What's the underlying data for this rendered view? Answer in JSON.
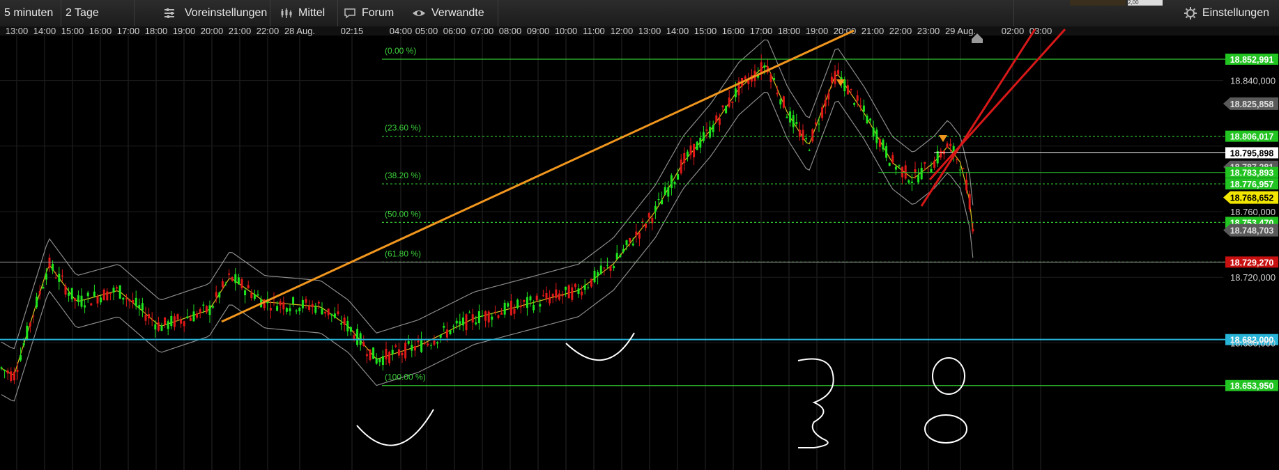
{
  "toolbar": {
    "interval": "5 minuten",
    "period": "2 Tage",
    "presets": "Voreinstellungen",
    "average": "Mittel",
    "forum": "Forum",
    "related": "Verwandte",
    "settings": "Einstellungen",
    "corner_value": "2,00"
  },
  "time_axis": [
    "13:00",
    "14:00",
    "15:00",
    "16:00",
    "17:00",
    "18:00",
    "19:00",
    "20:00",
    "21:00",
    "22:00",
    "28 Aug.",
    "02:15",
    "04:00",
    "05:00",
    "06:00",
    "07:00",
    "08:00",
    "09:00",
    "10:00",
    "11:00",
    "12:00",
    "13:00",
    "14:00",
    "15:00",
    "16:00",
    "17:00",
    "18:00",
    "19:00",
    "20:00",
    "21:00",
    "22:00",
    "23:00",
    "29 Aug.",
    "02:00",
    "03:00"
  ],
  "price_axis": [
    "18.840,000",
    "18.760,000",
    "18.720,000",
    "18.680,000"
  ],
  "fib_levels": [
    {
      "label": "(0.00 %)",
      "value": 18852.991
    },
    {
      "label": "(23.60 %)",
      "value": 18806.017
    },
    {
      "label": "(38.20 %)",
      "value": 18776.957
    },
    {
      "label": "(50.00 %)",
      "value": 18753.47
    },
    {
      "label": "(61.80 %)",
      "value": 18729.27
    },
    {
      "label": "(100.00 %)",
      "value": 18653.95
    }
  ],
  "price_labels": [
    {
      "text": "18.852,991",
      "value": 18852.991,
      "bg": "#22c422",
      "fg": "#ffffff",
      "shape": "rect"
    },
    {
      "text": "18.825,858",
      "value": 18825.858,
      "bg": "#5a5a5a",
      "fg": "#e0e0e0",
      "shape": "tag"
    },
    {
      "text": "18.806,017",
      "value": 18806.017,
      "bg": "#22c422",
      "fg": "#ffffff",
      "shape": "rect"
    },
    {
      "text": "18.795,898",
      "value": 18795.898,
      "bg": "#ffffff",
      "fg": "#000000",
      "shape": "rect"
    },
    {
      "text": "18.787,281",
      "value": 18787.281,
      "bg": "#5a5a5a",
      "fg": "#e0e0e0",
      "shape": "tag"
    },
    {
      "text": "18.783,893",
      "value": 18783.893,
      "bg": "#22c422",
      "fg": "#ffffff",
      "shape": "rect"
    },
    {
      "text": "18.776,957",
      "value": 18776.957,
      "bg": "#22c422",
      "fg": "#ffffff",
      "shape": "rect"
    },
    {
      "text": "18.768,652",
      "value": 18768.652,
      "bg": "#f2e600",
      "fg": "#000000",
      "shape": "tag"
    },
    {
      "text": "18.753,470",
      "value": 18753.47,
      "bg": "#22c422",
      "fg": "#ffffff",
      "shape": "rect"
    },
    {
      "text": "18.748,703",
      "value": 18748.703,
      "bg": "#5a5a5a",
      "fg": "#e0e0e0",
      "shape": "tag"
    },
    {
      "text": "18.729,270",
      "value": 18729.27,
      "bg": "#c81010",
      "fg": "#ffffff",
      "shape": "rect"
    },
    {
      "text": "18.682,000",
      "value": 18682,
      "bg": "#27b4d8",
      "fg": "#ffffff",
      "shape": "rect"
    },
    {
      "text": "18.653,950",
      "value": 18653.95,
      "bg": "#22c422",
      "fg": "#ffffff",
      "shape": "rect"
    }
  ],
  "colors": {
    "background": "#000000",
    "bull": "#1ee61e",
    "bear": "#e01818",
    "fib": "#2fc42f",
    "trend": "#f0961e",
    "channel": "#d81818",
    "bands": "#8c8c8c",
    "average": "#d8c020",
    "support": "#27b4d8"
  },
  "icons": [
    "presets-icon",
    "chart-bars-icon",
    "chat-icon",
    "eye-icon",
    "gear-icon",
    "home-marker-icon",
    "signal-arrow-icon"
  ]
}
